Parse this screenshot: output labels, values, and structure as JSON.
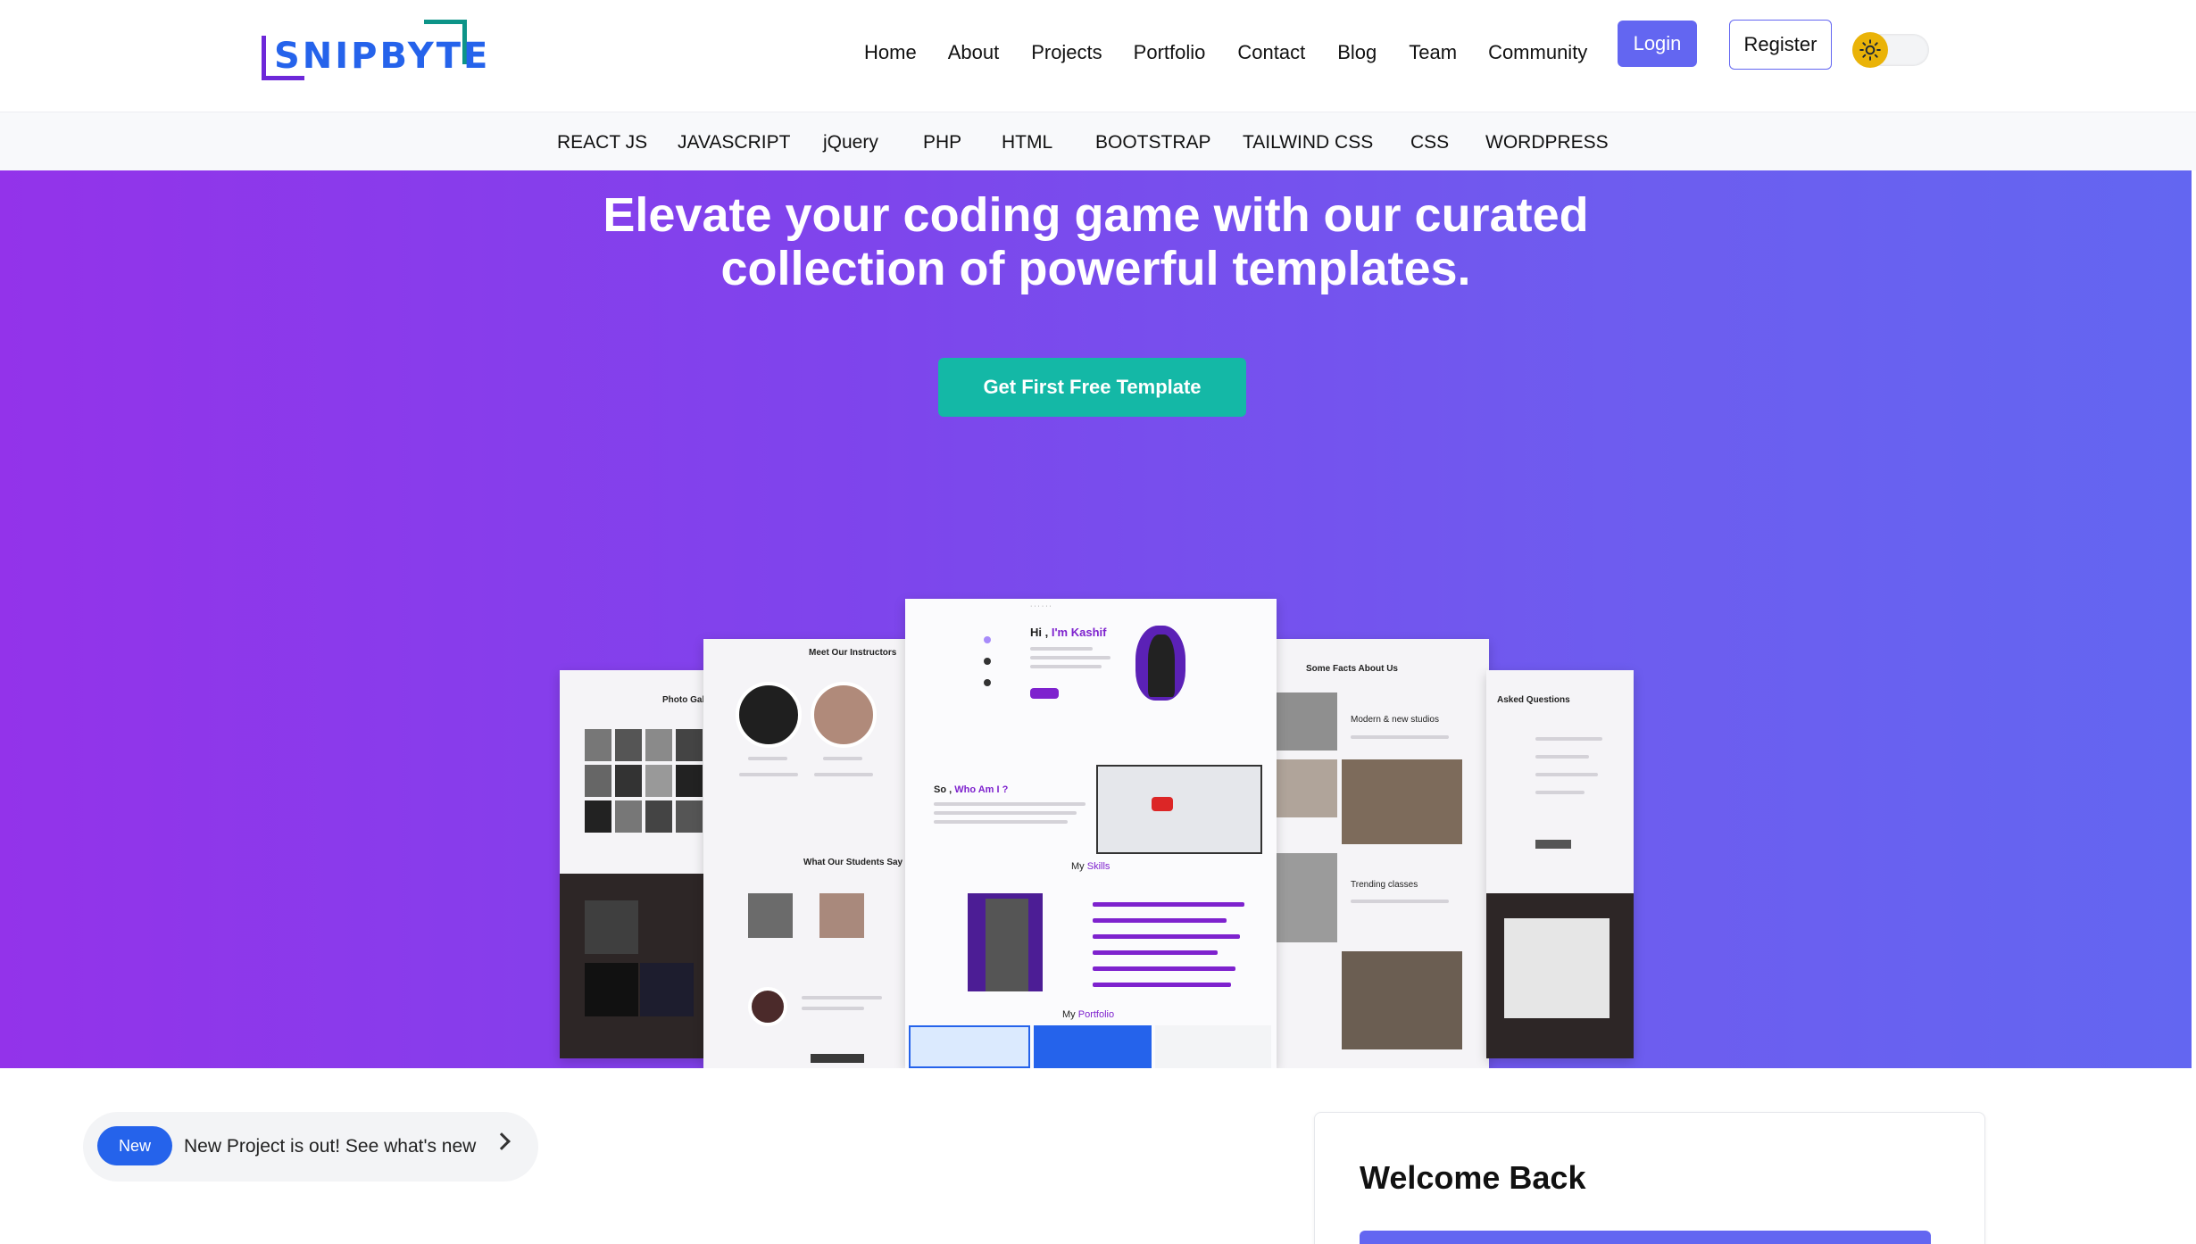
{
  "brand": {
    "logo_text": "SNIPBYTE"
  },
  "nav": {
    "links": [
      "Home",
      "About",
      "Projects",
      "Portfolio",
      "Contact",
      "Blog",
      "Team",
      "Community"
    ],
    "login_label": "Login",
    "register_label": "Register",
    "theme_toggle_icon": "sun-icon"
  },
  "categories": [
    "REACT JS",
    "JAVASCRIPT",
    "jQuery",
    "PHP",
    "HTML",
    "BOOTSTRAP",
    "TAILWIND CSS",
    "CSS",
    "WORDPRESS"
  ],
  "hero": {
    "title_line1": "Elevate your coding game with our curated",
    "title_line2": "collection of powerful templates.",
    "cta_label": "Get First Free Template"
  },
  "showcase": {
    "far_left_title": "Photo Gallery",
    "left_title": "Meet Our Instructors",
    "left_sub_title": "What Our Students Say",
    "center_greeting_prefix": "Hi , ",
    "center_greeting_name": "I'm Kashif",
    "center_about_prefix": "So , ",
    "center_about_highlight": "Who Am I ?",
    "center_skills_prefix": "My ",
    "center_skills_highlight": "Skills",
    "center_portfolio_prefix": "My ",
    "center_portfolio_highlight": "Portfolio",
    "right_title": "Some Facts About Us",
    "right_sub1": "Modern & new studios",
    "right_sub2": "Trending classes",
    "far_right_title": "Asked Questions"
  },
  "announcement": {
    "badge": "New",
    "text": "New Project is out! See what's new"
  },
  "welcome": {
    "title": "Welcome Back"
  },
  "colors": {
    "accent": "#6366f1",
    "cta": "#14b8a6",
    "hero_gradient_start": "#9333ea",
    "hero_gradient_end": "#6366f1",
    "badge": "#2563eb"
  }
}
